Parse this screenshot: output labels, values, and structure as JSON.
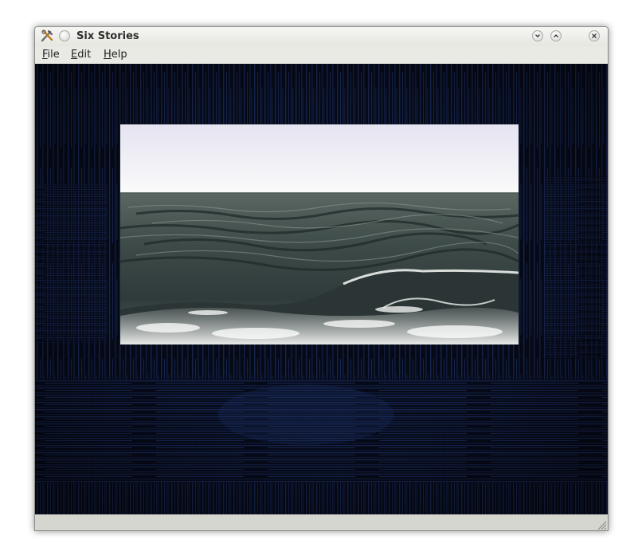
{
  "window": {
    "title": "Six Stories",
    "app_icon": "tools-icon"
  },
  "titlebar_buttons": {
    "menu": "circle-icon",
    "minimize": "chevron-down-icon",
    "maximize": "chevron-up-icon",
    "close": "close-icon"
  },
  "menu": {
    "file": {
      "mnemonic": "F",
      "rest": "ile"
    },
    "edit": {
      "mnemonic": "E",
      "rest": "dit"
    },
    "help": {
      "mnemonic": "H",
      "rest": "elp"
    }
  },
  "colors": {
    "background": "#060a17",
    "texture_blue": "#1d2f66",
    "chrome": "#e9eae4"
  }
}
